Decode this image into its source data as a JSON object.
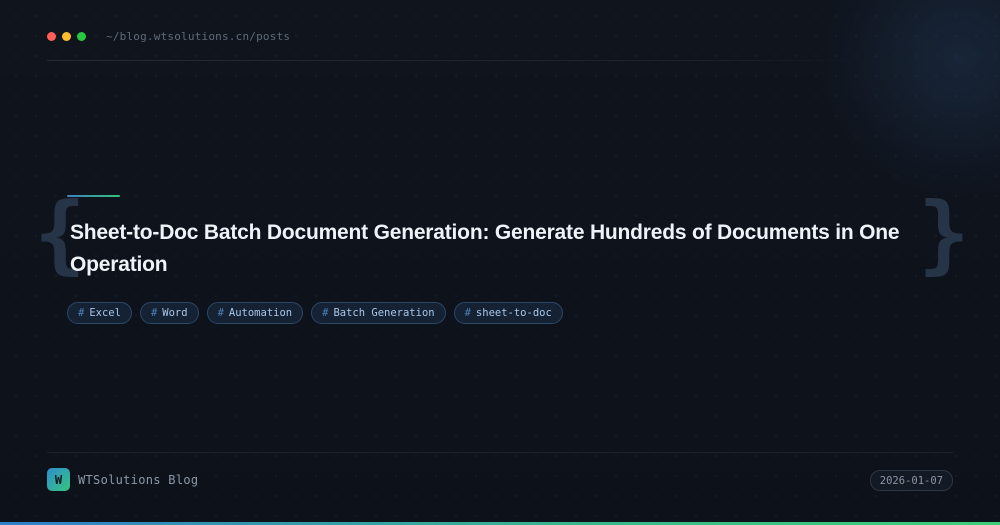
{
  "window": {
    "dots": [
      {
        "name": "close",
        "color": "#ff5f57"
      },
      {
        "name": "minimize",
        "color": "#febc2e"
      },
      {
        "name": "maximize",
        "color": "#28c840"
      }
    ],
    "path": "~/blog.wtsolutions.cn/posts"
  },
  "hero": {
    "brace_left": "{",
    "brace_right": "}",
    "title": "Sheet-to-Doc Batch Document Generation: Generate Hundreds of Documents in One Operation",
    "tags": [
      {
        "hash": "#",
        "label": "Excel"
      },
      {
        "hash": "#",
        "label": "Word"
      },
      {
        "hash": "#",
        "label": "Automation"
      },
      {
        "hash": "#",
        "label": "Batch Generation"
      },
      {
        "hash": "#",
        "label": "sheet-to-doc"
      }
    ]
  },
  "footer": {
    "logo_letter": "W",
    "brand_name": "WTSolutions Blog",
    "date": "2026-01-07"
  },
  "colors": {
    "accent_blue": "#2f7fc9",
    "accent_green": "#3bcf7a",
    "background": "#0f141d"
  }
}
